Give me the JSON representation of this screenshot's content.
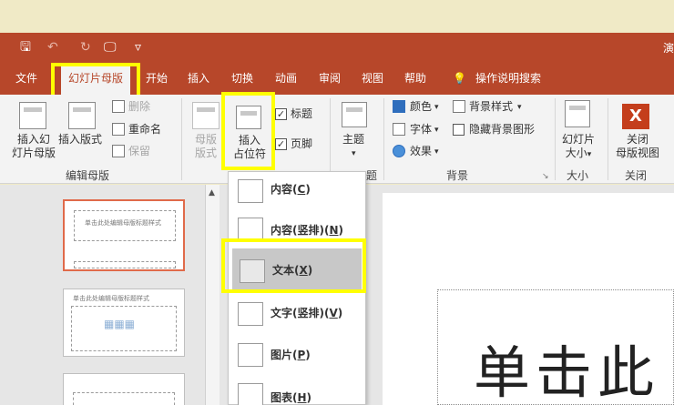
{
  "window": {
    "title_fragment": "演"
  },
  "quick_access": {
    "save_icon": "save-icon",
    "undo_icon": "undo-icon",
    "redo_icon": "redo-icon",
    "present_icon": "present-from-start-icon",
    "customize_icon": "customize-dropdown-icon",
    "save_glyph": "🖫",
    "undo_glyph": "↶",
    "redo_glyph": "↻",
    "present_glyph": "🖵",
    "customize_glyph": "▿"
  },
  "tabs": [
    {
      "label": "文件"
    },
    {
      "label": "幻灯片母版"
    },
    {
      "label": "开始"
    },
    {
      "label": "插入"
    },
    {
      "label": "切换"
    },
    {
      "label": "动画"
    },
    {
      "label": "审阅"
    },
    {
      "label": "视图"
    },
    {
      "label": "帮助"
    },
    {
      "label": "操作说明搜索"
    }
  ],
  "ribbon": {
    "edit_master": {
      "insert_slide_master_l1": "插入幻",
      "insert_slide_master_l2": "灯片母版",
      "insert_layout": "插入版式",
      "delete": "删除",
      "rename": "重命名",
      "preserve": "保留",
      "group_label": "编辑母版"
    },
    "master_layout": {
      "master_layout_l1": "母版",
      "master_layout_l2": "版式",
      "insert_l1": "插入",
      "insert_l2": "占位符",
      "title_check": "标题",
      "footer_check": "页脚",
      "group_label": "题"
    },
    "theme": {
      "label": "主题",
      "arrow": "▾"
    },
    "background": {
      "colors": "颜色",
      "fonts": "字体",
      "effects": "效果",
      "bg_styles": "背景样式",
      "hide_bg": "隐藏背景图形",
      "group_label": "背景",
      "launcher": "↘",
      "arrow": "▾"
    },
    "size": {
      "l1": "幻灯片",
      "l2": "大小",
      "group_label": "大小",
      "arrow": "▾"
    },
    "close": {
      "l1": "关闭",
      "l2": "母版视图",
      "group_label": "关闭",
      "glyph": "X"
    },
    "check_glyph": "✓"
  },
  "placeholder_menu": [
    {
      "label": "内容",
      "key": "C"
    },
    {
      "label": "内容(竖排)",
      "key": "N"
    },
    {
      "label": "文本",
      "key": "X"
    },
    {
      "label": "文字(竖排)",
      "key": "V"
    },
    {
      "label": "图片",
      "key": "P"
    },
    {
      "label": "图表",
      "key": "H"
    }
  ],
  "thumbnails": [
    {
      "text": "单击此处编辑母版标题样式"
    },
    {
      "text": "单击此处编辑母版标题样式"
    }
  ],
  "slide": {
    "title_fragment": "单击此"
  },
  "scroll": {
    "up_arrow": "▲"
  },
  "colors": {
    "accent": "#b7472a",
    "highlight": "#ffff00",
    "selected_thumb": "#e06a4a"
  }
}
